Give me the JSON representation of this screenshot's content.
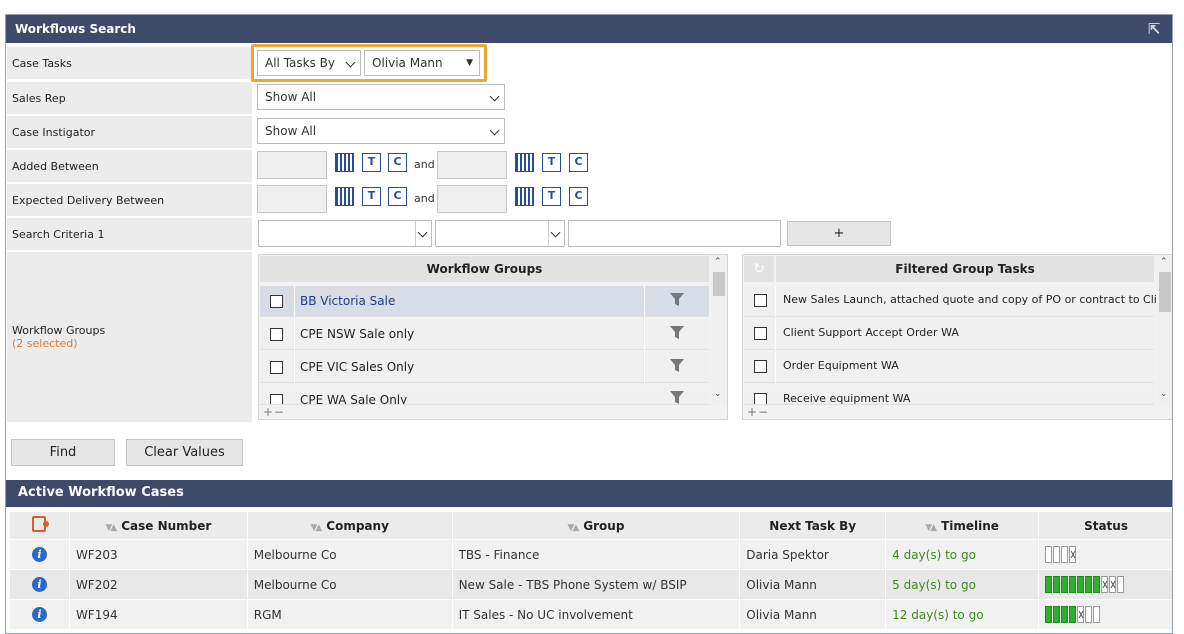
{
  "search": {
    "title": "Workflows Search",
    "rows": {
      "case_tasks": {
        "label": "Case Tasks",
        "filter": "All Tasks By",
        "user": "Olivia Mann"
      },
      "sales_rep": {
        "label": "Sales Rep",
        "value": "Show All"
      },
      "case_instigator": {
        "label": "Case Instigator",
        "value": "Show All"
      },
      "added_between": {
        "label": "Added Between",
        "and": "and"
      },
      "expected_delivery": {
        "label": "Expected Delivery Between",
        "and": "and"
      },
      "search_criteria": {
        "label": "Search Criteria 1",
        "add": "+"
      },
      "workflow_groups": {
        "label": "Workflow Groups",
        "count": "(2 selected)"
      }
    },
    "workflow_groups": {
      "header": "Workflow Groups",
      "items": [
        "BB Victoria Sale",
        "CPE NSW Sale only",
        "CPE VIC Sales Only",
        "CPE WA Sale Only"
      ],
      "pm": "+−"
    },
    "filtered_tasks": {
      "header": "Filtered Group Tasks",
      "items": [
        "New Sales Launch, attached quote and copy of PO or contract to Client",
        "Client Support Accept Order WA",
        "Order Equipment WA",
        "Receive equipment WA"
      ],
      "pm": "+−"
    },
    "find_label": "Find",
    "clear_label": "Clear Values",
    "cal_t": "T",
    "cal_c": "C"
  },
  "cases": {
    "title": "Active Workflow Cases",
    "columns": [
      "Case Number",
      "Company",
      "Group",
      "Next Task By",
      "Timeline",
      "Status"
    ],
    "rows": [
      {
        "case": "WF203",
        "company": "Melbourne Co",
        "group": "TBS - Finance",
        "next": "Daria Spektor",
        "timeline": "4 day(s) to go"
      },
      {
        "case": "WF202",
        "company": "Melbourne Co",
        "group": "New Sale - TBS Phone System w/ BSIP",
        "next": "Olivia Mann",
        "timeline": "5 day(s) to go"
      },
      {
        "case": "WF194",
        "company": "RGM",
        "group": "IT Sales - No UC involvement",
        "next": "Olivia Mann",
        "timeline": "12 day(s) to go"
      }
    ],
    "info_glyph": "i"
  },
  "colors": {
    "header": "#3d4a6a",
    "highlight": "#e8a938",
    "accent_orange": "#e05a2b",
    "green": "#3a8b1a"
  }
}
